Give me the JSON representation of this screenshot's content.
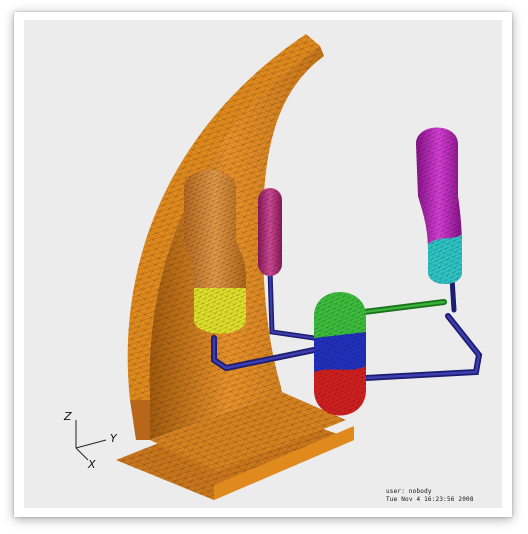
{
  "axes": {
    "z": "Z",
    "y": "Y",
    "x": "X"
  },
  "stamp": {
    "user": "user: nobody",
    "date": "Tue Nov  4 16:23:56 2008"
  },
  "colors": {
    "background": "#ececec",
    "shield": "#e08a1e",
    "vessel_upper": "#d88a2c",
    "vessel_lower": "#e6e62c",
    "pressurizer": "#c8368a",
    "steam_generator_upper": "#c020c0",
    "steam_generator_lower": "#30c8c8",
    "pump_top": "#40c040",
    "pump_middle": "#2030c0",
    "pump_bottom": "#d02020",
    "piping": "#2a2a8a"
  }
}
